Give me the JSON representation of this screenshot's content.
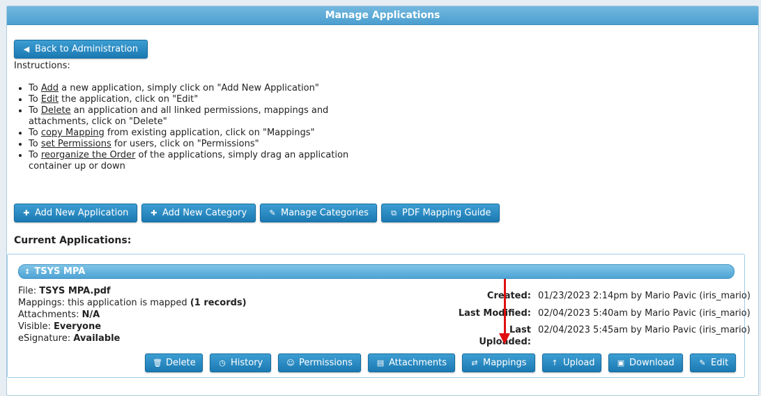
{
  "header": {
    "title": "Manage Applications"
  },
  "back_button": {
    "label": "Back to Administration"
  },
  "instructions": {
    "title": "Instructions:",
    "items": [
      {
        "pre": "To ",
        "link": "Add",
        "post": " a new application, simply click on \"Add New Application\""
      },
      {
        "pre": "To ",
        "link": "Edit",
        "post": " the application, click on \"Edit\""
      },
      {
        "pre": "To ",
        "link": "Delete",
        "post": " an application and all linked permissions, mappings and attachments, click on \"Delete\""
      },
      {
        "pre": "To ",
        "link": "copy Mapping",
        "post": " from existing application, click on \"Mappings\""
      },
      {
        "pre": "To ",
        "link": "set Permissions",
        "post": " for users, click on \"Permissions\""
      },
      {
        "pre": "To ",
        "link": "reorganize the Order",
        "post": " of the applications, simply drag an application container up or down"
      }
    ]
  },
  "toolbar": {
    "add_application": "Add New Application",
    "add_category": "Add New Category",
    "manage_categories": "Manage Categories",
    "pdf_mapping_guide": "PDF Mapping Guide"
  },
  "current_title": "Current Applications:",
  "application": {
    "name": "TSYS MPA",
    "file_label": "File:",
    "file_value": "TSYS MPA.pdf",
    "mappings_label": "Mappings: this application is mapped",
    "mappings_value": "(1 records)",
    "attachments_label": "Attachments:",
    "attachments_value": "N/A",
    "visible_label": "Visible:",
    "visible_value": "Everyone",
    "esignature_label": "eSignature:",
    "esignature_value": "Available",
    "created_label": "Created:",
    "created_value": "01/23/2023 2:14pm by Mario Pavic (iris_mario)",
    "modified_label": "Last Modified:",
    "modified_value": "02/04/2023 5:40am by Mario Pavic (iris_mario)",
    "uploaded_label_1": "Last",
    "uploaded_label_2": "Uploaded:",
    "uploaded_value": "02/04/2023 5:45am by Mario Pavic (iris_mario)",
    "buttons": {
      "delete": "Delete",
      "history": "History",
      "permissions": "Permissions",
      "attachments": "Attachments",
      "mappings": "Mappings",
      "upload": "Upload",
      "download": "Download",
      "edit": "Edit"
    }
  },
  "colors": {
    "accent": "#1f7fb8",
    "header": "#5aa9d6",
    "arrow": "#e01010"
  }
}
